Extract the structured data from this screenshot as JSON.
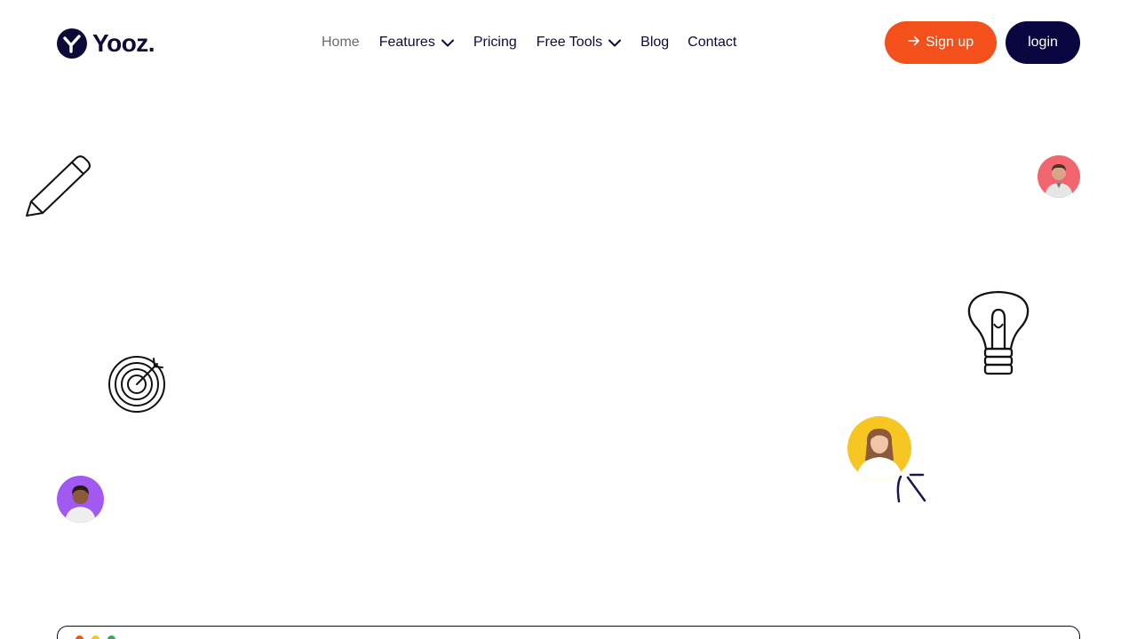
{
  "brand": {
    "name": "Yooz."
  },
  "nav": {
    "items": [
      {
        "label": "Home",
        "active": true
      },
      {
        "label": "Features",
        "dropdown": true
      },
      {
        "label": "Pricing"
      },
      {
        "label": "Free Tools",
        "dropdown": true
      },
      {
        "label": "Blog"
      },
      {
        "label": "Contact"
      }
    ]
  },
  "actions": {
    "signup_label": "Sign up",
    "login_label": "login"
  },
  "icons": {
    "logo": "yooz-logo-icon",
    "signup": "arrow-right-icon",
    "decorations": [
      "pencil-icon",
      "target-icon",
      "lightbulb-icon",
      "sparkle-icon"
    ]
  },
  "colors": {
    "brand_dark": "#0a0640",
    "accent_orange": "#f4501c",
    "avatar_pink": "#f2646e",
    "avatar_purple": "#a259f2",
    "avatar_yellow": "#f8c623"
  }
}
